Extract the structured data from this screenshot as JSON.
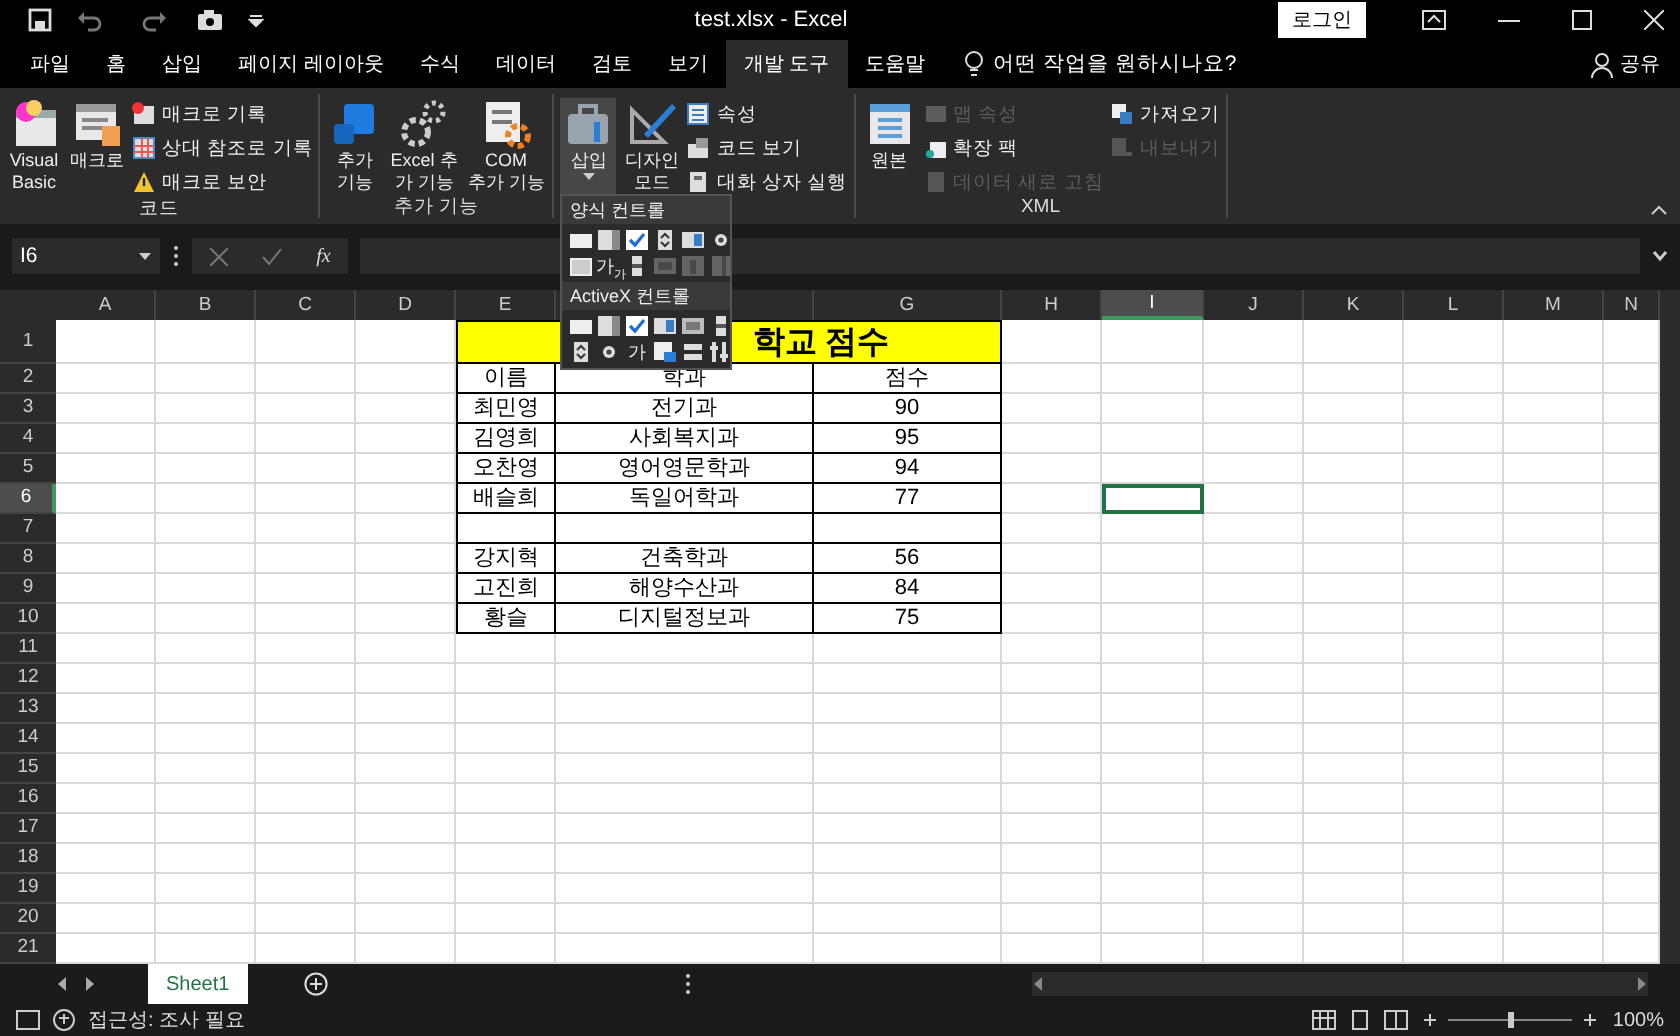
{
  "title_bar": {
    "title": "test.xlsx  -  Excel",
    "login": "로그인"
  },
  "menu_tabs": [
    {
      "label": "파일",
      "selected": false
    },
    {
      "label": "홈",
      "selected": false
    },
    {
      "label": "삽입",
      "selected": false
    },
    {
      "label": "페이지 레이아웃",
      "selected": false
    },
    {
      "label": "수식",
      "selected": false
    },
    {
      "label": "데이터",
      "selected": false
    },
    {
      "label": "검토",
      "selected": false
    },
    {
      "label": "보기",
      "selected": false
    },
    {
      "label": "개발 도구",
      "selected": true
    },
    {
      "label": "도움말",
      "selected": false
    }
  ],
  "tell_me": "어떤 작업을 원하시나요?",
  "share": "공유",
  "ribbon": {
    "groups": [
      {
        "label": "코드",
        "items": [
          {
            "kind": "large",
            "label": "Visual\nBasic"
          },
          {
            "kind": "large",
            "label": "매크로"
          },
          {
            "kind": "small",
            "label": "매크로 기록",
            "disabled": false
          },
          {
            "kind": "small",
            "label": "상대 참조로 기록",
            "disabled": false
          },
          {
            "kind": "small",
            "label": "매크로 보안",
            "disabled": false
          }
        ]
      },
      {
        "label": "추가 기능",
        "items": [
          {
            "kind": "large",
            "label": "추가\n기능"
          },
          {
            "kind": "large",
            "label": "Excel 추\n가 기능"
          },
          {
            "kind": "large",
            "label": "COM\n추가 기능"
          }
        ]
      },
      {
        "items": [
          {
            "kind": "large",
            "label": "삽입",
            "dropdown": true
          },
          {
            "kind": "large",
            "label": "디자인\n모드"
          },
          {
            "kind": "small",
            "label": "속성",
            "disabled": false
          },
          {
            "kind": "small",
            "label": "코드 보기",
            "disabled": false
          },
          {
            "kind": "small",
            "label": "대화 상자 실행",
            "disabled": false
          }
        ]
      },
      {
        "label": "XML",
        "items": [
          {
            "kind": "large",
            "label": "원본"
          },
          {
            "kind": "small",
            "label": "맵 속성",
            "disabled": true
          },
          {
            "kind": "small",
            "label": "확장 팩",
            "disabled": false
          },
          {
            "kind": "small",
            "label": "데이터 새로 고침",
            "disabled": true
          },
          {
            "kind": "small",
            "label": "가져오기",
            "disabled": false
          },
          {
            "kind": "small",
            "label": "내보내기",
            "disabled": true
          }
        ]
      }
    ]
  },
  "insert_menu": {
    "sections": [
      {
        "title": "양식 컨트롤",
        "controls": [
          {
            "kind": "button",
            "disabled": false
          },
          {
            "kind": "combo",
            "disabled": false
          },
          {
            "kind": "checkbox",
            "disabled": false
          },
          {
            "kind": "spin",
            "disabled": false
          },
          {
            "kind": "listbox",
            "disabled": false
          },
          {
            "kind": "option",
            "disabled": false
          },
          {
            "kind": "groupbox",
            "disabled": false
          },
          {
            "kind": "label",
            "text": "가$_{가}$",
            "disabled": false
          },
          {
            "kind": "scrollbar",
            "disabled": false
          },
          {
            "kind": "textbox",
            "disabled": true
          },
          {
            "kind": "combolist",
            "disabled": true
          },
          {
            "kind": "combodrop",
            "disabled": true
          }
        ]
      },
      {
        "title": "ActiveX 컨트롤",
        "controls": [
          {
            "kind": "button",
            "disabled": false
          },
          {
            "kind": "combo",
            "disabled": false
          },
          {
            "kind": "checkbox",
            "disabled": false
          },
          {
            "kind": "listbox",
            "disabled": false
          },
          {
            "kind": "textbox",
            "disabled": false
          },
          {
            "kind": "scrollbar",
            "disabled": false
          },
          {
            "kind": "spin",
            "disabled": false
          },
          {
            "kind": "option",
            "disabled": false
          },
          {
            "kind": "label",
            "text": "가",
            "disabled": false
          },
          {
            "kind": "image",
            "disabled": false
          },
          {
            "kind": "toggle",
            "disabled": false
          },
          {
            "kind": "more",
            "disabled": false
          }
        ]
      }
    ]
  },
  "formula_bar": {
    "name_box": "I6",
    "fx": "fx"
  },
  "sheet": {
    "columns": [
      {
        "label": "A",
        "selected": false
      },
      {
        "label": "B",
        "selected": false
      },
      {
        "label": "C",
        "selected": false
      },
      {
        "label": "D",
        "selected": false
      },
      {
        "label": "E",
        "selected": false
      },
      {
        "selected": false
      },
      {
        "label": "G",
        "selected": false
      },
      {
        "label": "H",
        "selected": false
      },
      {
        "label": "I",
        "selected": true
      },
      {
        "label": "J",
        "selected": false
      },
      {
        "label": "K",
        "selected": false
      },
      {
        "label": "L",
        "selected": false
      },
      {
        "label": "M",
        "selected": false
      },
      {
        "label": "N",
        "selected": false
      }
    ],
    "rows": [
      {
        "label": "1",
        "selected": false,
        "title": "학교 점수"
      },
      {
        "label": "2",
        "selected": false,
        "cells": [
          "이름",
          "학과",
          "점수"
        ]
      },
      {
        "label": "3",
        "selected": false,
        "cells": [
          "최민영",
          "전기과",
          "90"
        ]
      },
      {
        "label": "4",
        "selected": false,
        "cells": [
          "김영희",
          "사회복지과",
          "95"
        ]
      },
      {
        "label": "5",
        "selected": false,
        "cells": [
          "오찬영",
          "영어영문학과",
          "94"
        ]
      },
      {
        "label": "6",
        "selected": true,
        "cells": [
          "배슬희",
          "독일어학과",
          "77"
        ]
      },
      {
        "label": "7",
        "selected": false
      },
      {
        "label": "8",
        "selected": false,
        "cells": [
          "강지혁",
          "건축학과",
          "56"
        ]
      },
      {
        "label": "9",
        "selected": false,
        "cells": [
          "고진희",
          "해양수산과",
          "84"
        ]
      },
      {
        "label": "10",
        "selected": false,
        "cells": [
          "황슬",
          "디지털정보과",
          "75"
        ]
      },
      {
        "label": "11",
        "selected": false
      },
      {
        "label": "12",
        "selected": false
      },
      {
        "label": "13",
        "selected": false
      },
      {
        "label": "14",
        "selected": false
      },
      {
        "label": "15",
        "selected": false
      },
      {
        "label": "16",
        "selected": false
      },
      {
        "label": "17",
        "selected": false
      },
      {
        "label": "18",
        "selected": false
      },
      {
        "label": "19",
        "selected": false
      },
      {
        "label": "20",
        "selected": false
      },
      {
        "label": "21",
        "selected": false
      }
    ]
  },
  "sheet_tabs": [
    {
      "label": "Sheet1",
      "selected": true
    }
  ],
  "status_bar": {
    "accessibility": "접근성: 조사 필요",
    "zoom": "100%"
  }
}
